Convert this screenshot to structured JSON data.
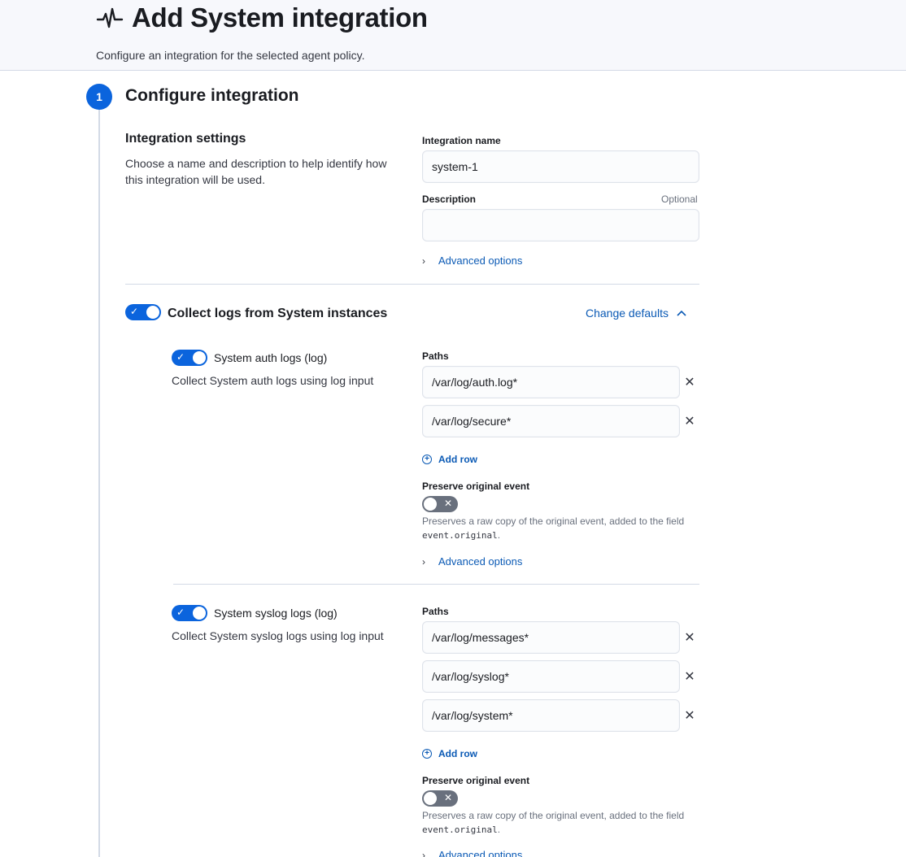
{
  "header": {
    "title": "Add System integration",
    "subtitle": "Configure an integration for the selected agent policy."
  },
  "step": {
    "number": "1",
    "title": "Configure integration"
  },
  "settings": {
    "heading": "Integration settings",
    "description": "Choose a name and description to help identify how this integration will be used.",
    "name_label": "Integration name",
    "name_value": "system-1",
    "description_label": "Description",
    "description_optional": "Optional",
    "description_value": "",
    "advanced_options": "Advanced options"
  },
  "collect": {
    "title": "Collect logs from System instances",
    "change_defaults": "Change defaults",
    "enabled": true
  },
  "auth": {
    "title": "System auth logs (log)",
    "description": "Collect System auth logs using log input",
    "paths_label": "Paths",
    "paths": [
      "/var/log/auth.log*",
      "/var/log/secure*"
    ],
    "add_row": "Add row",
    "preserve_label": "Preserve original event",
    "preserve_help_prefix": "Preserves a raw copy of the original event, added to the field ",
    "preserve_help_code": "event.original",
    "preserve_help_suffix": ".",
    "advanced_options": "Advanced options",
    "enabled": true
  },
  "syslog": {
    "title": "System syslog logs (log)",
    "description": "Collect System syslog logs using log input",
    "paths_label": "Paths",
    "paths": [
      "/var/log/messages*",
      "/var/log/syslog*",
      "/var/log/system*"
    ],
    "add_row": "Add row",
    "preserve_label": "Preserve original event",
    "preserve_help_prefix": "Preserves a raw copy of the original event, added to the field ",
    "preserve_help_code": "event.original",
    "preserve_help_suffix": ".",
    "advanced_options": "Advanced options",
    "enabled": true
  },
  "colors": {
    "primary": "#0b64dd",
    "link": "#0b5ab5",
    "header_bg": "#f7f8fc"
  },
  "icons": {
    "logo": "pulse-icon",
    "check": "check-icon",
    "cross": "cross-icon",
    "chevron_right": "chevron-right-icon",
    "chevron_up": "chevron-up-icon",
    "plus_circle": "plus-circle-icon"
  }
}
